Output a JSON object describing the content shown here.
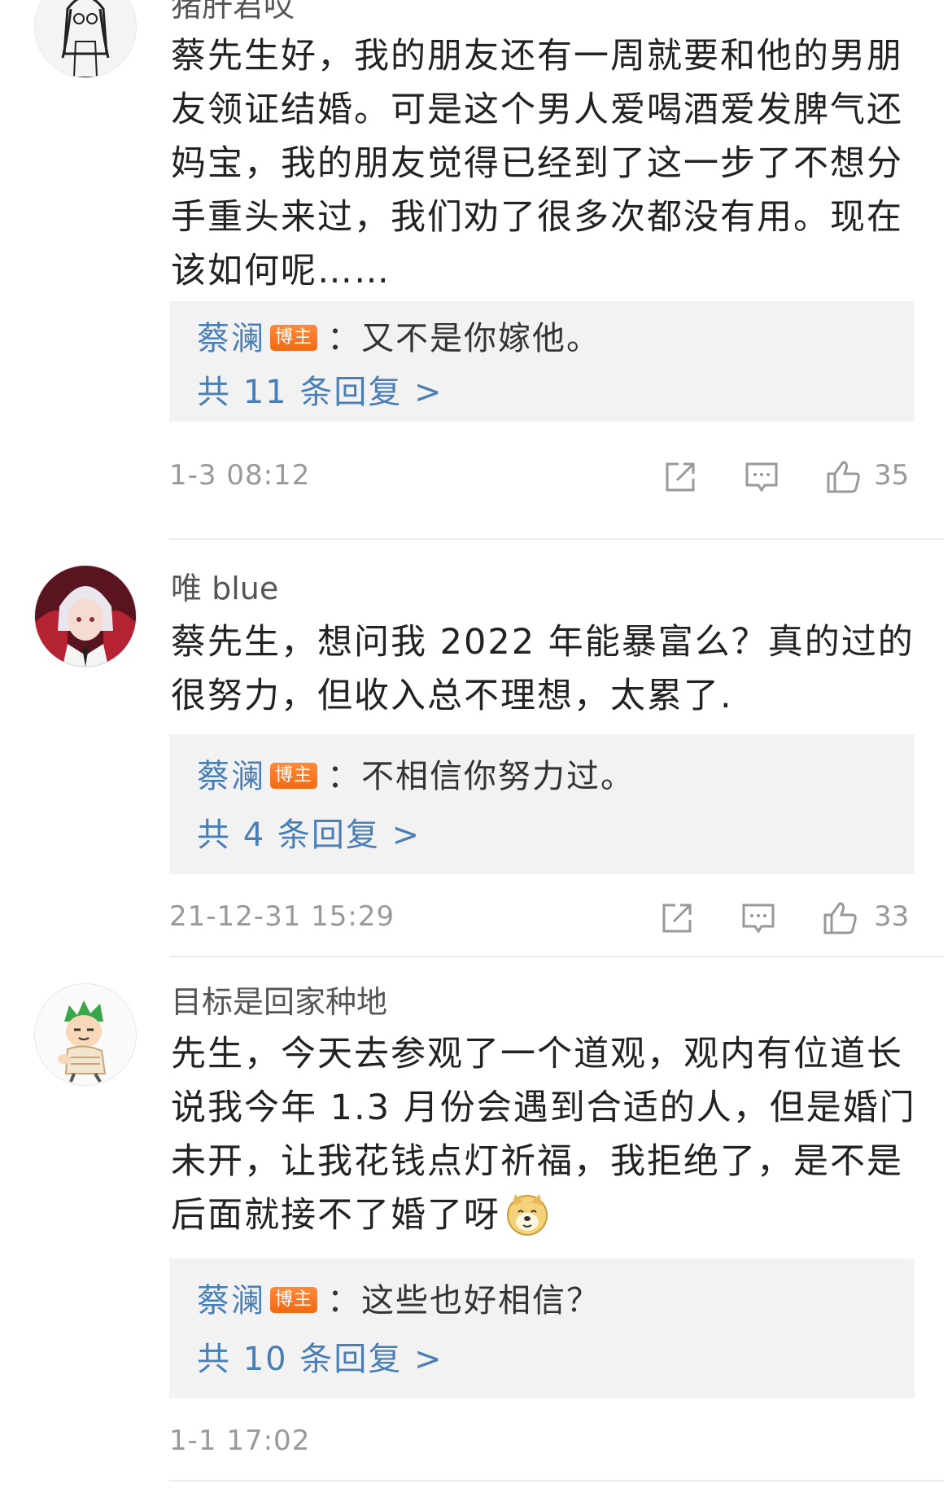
{
  "comments": [
    {
      "username": "猪肝君哎",
      "avatar_icon": "girl-sketch-avatar",
      "text": "蔡先生好，我的朋友还有一周就要和他的男朋友领证结婚。可是这个男人爱喝酒爱发脾气还妈宝，我的朋友觉得已经到了这一步了不想分手重头来过，我们劝了很多次都没有用。现在该如何呢……",
      "reply": {
        "author": "蔡澜",
        "badge": "博主",
        "text": "：又不是你嫁他。",
        "more": "共 11 条回复 >"
      },
      "timestamp": "1-3 08:12",
      "likes": "35"
    },
    {
      "username": "唯 blue",
      "avatar_icon": "anime-character-avatar",
      "text": "蔡先生，想问我 2022 年能暴富么？真的过的很努力，但收入总不理想，太累了.",
      "reply": {
        "author": "蔡澜",
        "badge": "博主",
        "text": "：不相信你努力过。",
        "more": "共 4 条回复 >"
      },
      "timestamp": "21-12-31 15:29",
      "likes": "33"
    },
    {
      "username": "目标是回家种地",
      "avatar_icon": "cartoon-character-avatar",
      "text": "先生，今天去参观了一个道观，观内有位道长说我今年 1.3 月份会遇到合适的人，但是婚门未开，让我花钱点灯祈福，我拒绝了，是不是后面就接不了婚了呀",
      "emoji": "doge-emoji",
      "reply": {
        "author": "蔡澜",
        "badge": "博主",
        "text": "：这些也好相信？",
        "more": "共 10 条回复 >"
      },
      "timestamp": "1-1 17:02"
    }
  ],
  "icons": {
    "share": "share-icon",
    "comment": "comment-icon",
    "like": "thumbs-up-icon"
  },
  "colors": {
    "link_blue": "#4a7fb5",
    "badge_orange": "#f06a14",
    "reply_bg": "#f2f2f2",
    "meta_gray": "#999999"
  }
}
